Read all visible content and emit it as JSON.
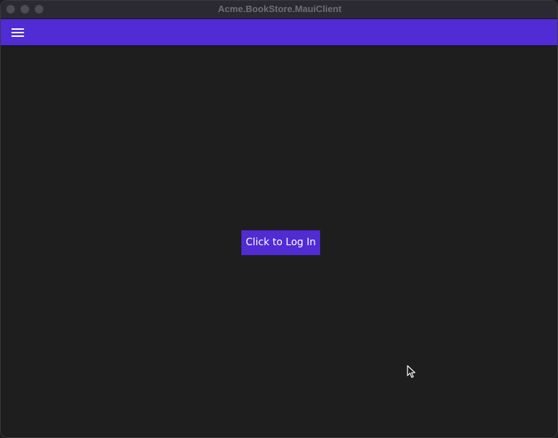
{
  "window": {
    "title": "Acme.BookStore.MauiClient"
  },
  "navbar": {
    "menu_icon": "hamburger-menu-icon",
    "background_color": "#512bd4"
  },
  "main": {
    "login_button_label": "Click to Log In"
  },
  "colors": {
    "accent": "#512bd4",
    "background": "#1e1e1e",
    "titlebar": "#2b2a33"
  }
}
